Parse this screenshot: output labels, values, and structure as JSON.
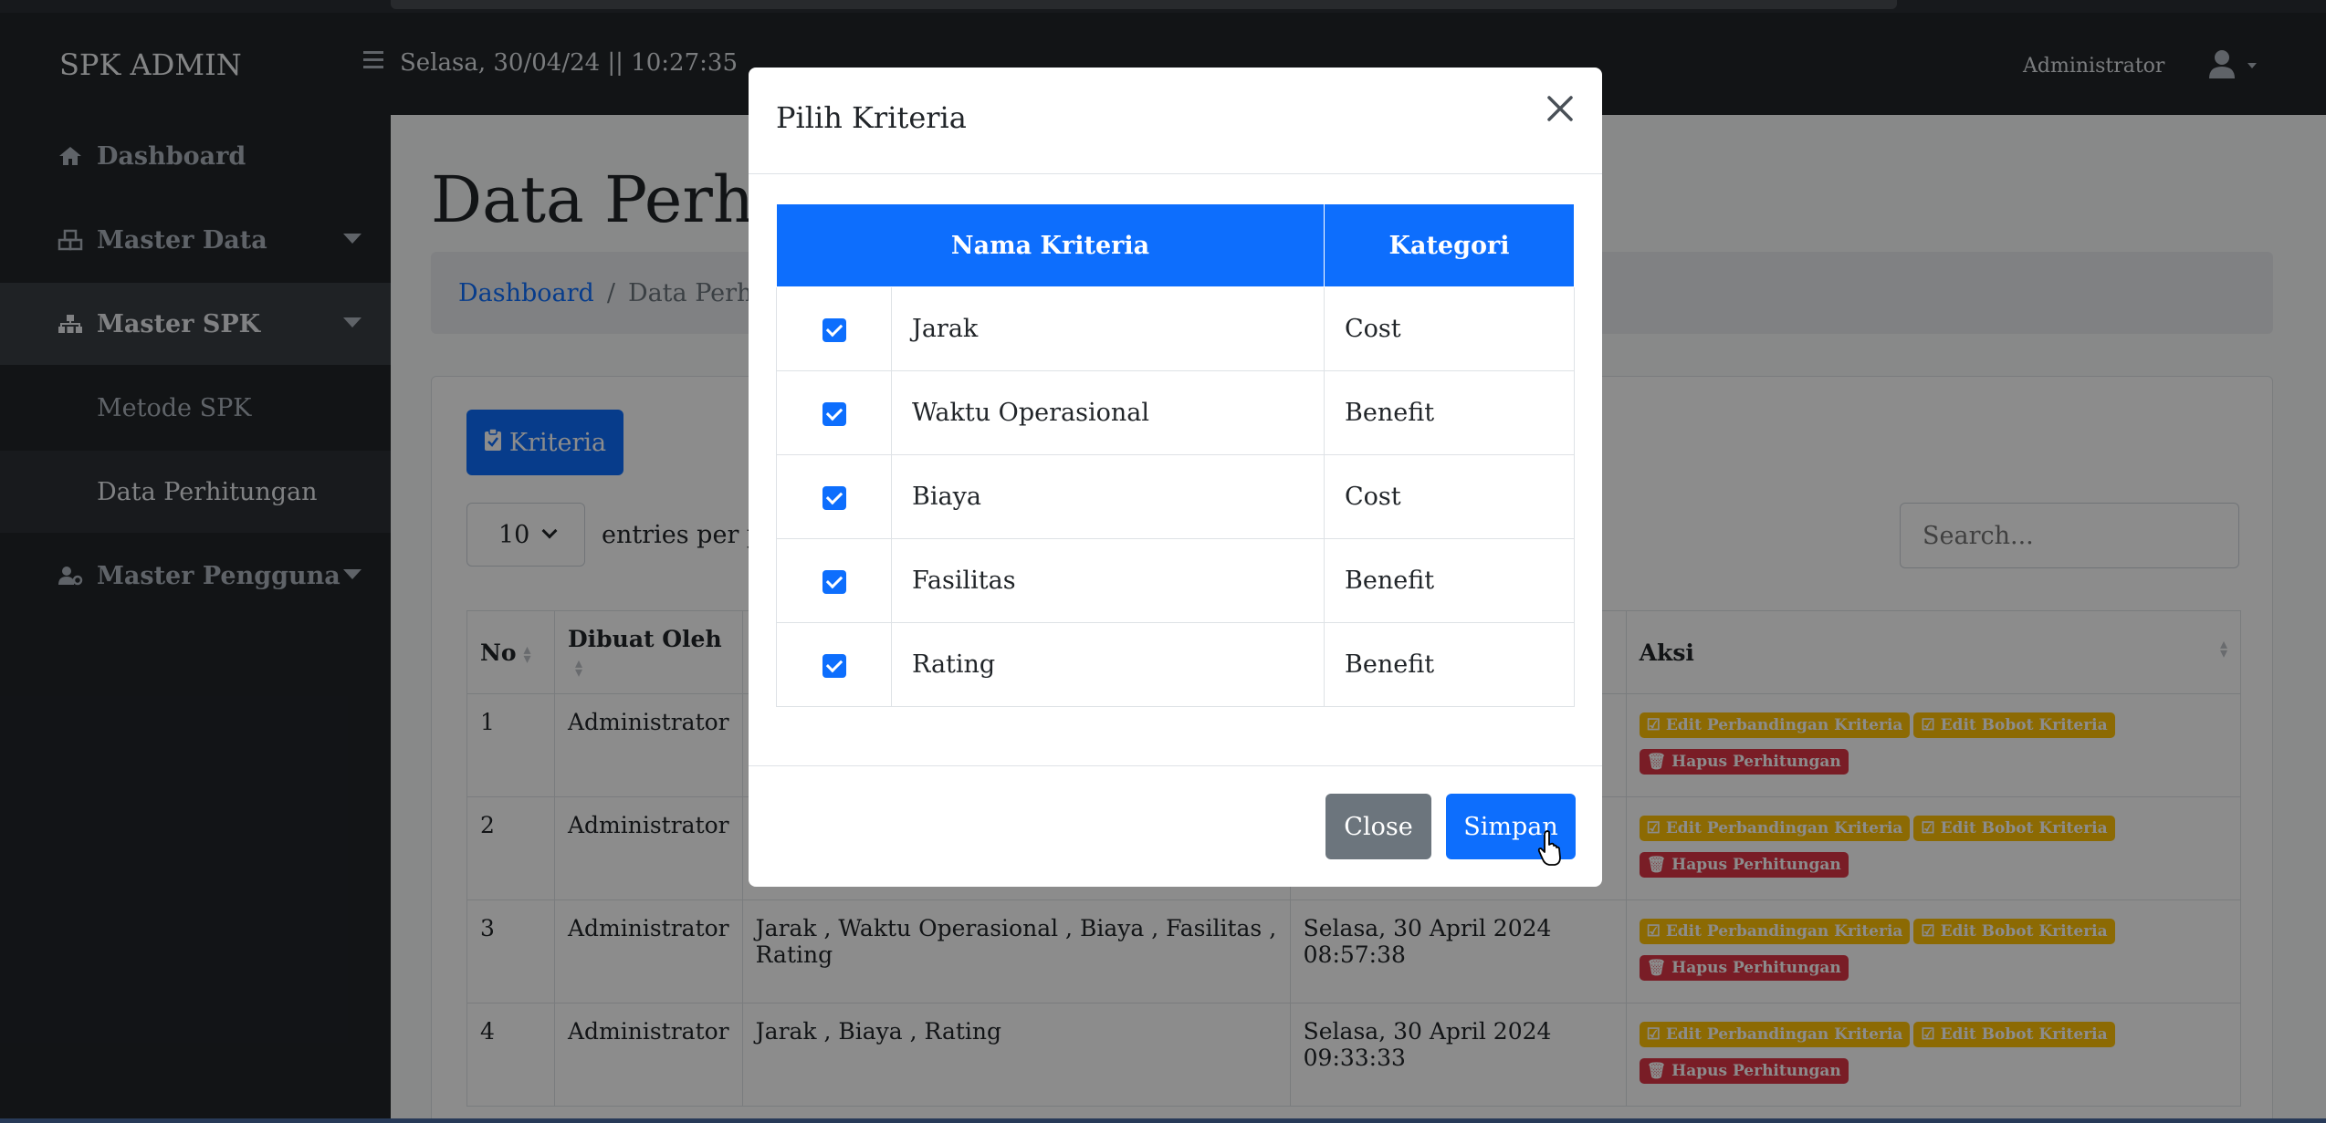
{
  "navbar": {
    "brand": "SPK ADMIN",
    "datetime": "Selasa, 30/04/24 || 10:27:35",
    "user_name": "Administrator"
  },
  "sidebar": {
    "items": [
      {
        "label": "Dashboard",
        "icon": "home-icon"
      },
      {
        "label": "Master Data",
        "icon": "cubes-icon"
      },
      {
        "label": "Master SPK",
        "icon": "sitemap-icon"
      },
      {
        "label": "Metode SPK"
      },
      {
        "label": "Data Perhitungan"
      },
      {
        "label": "Master Pengguna",
        "icon": "users-gear-icon"
      }
    ]
  },
  "main": {
    "title": "Data Perhitu",
    "breadcrumb": {
      "home": "Dashboard",
      "current": "Data Perhitu"
    },
    "kriteria_button": "Kriteria",
    "entries_value": "10",
    "entries_label": "entries per pa",
    "search_placeholder": "Search...",
    "table": {
      "headers": [
        "No",
        "Dibuat Oleh",
        "",
        "",
        "Aksi"
      ],
      "rows": [
        {
          "no": "1",
          "by": "Administrator",
          "kriteria": "",
          "date": ""
        },
        {
          "no": "2",
          "by": "Administrator",
          "kriteria": "",
          "date": ""
        },
        {
          "no": "3",
          "by": "Administrator",
          "kriteria": "Jarak , Waktu Operasional , Biaya , Fasilitas , Rating",
          "date": "Selasa, 30 April 2024 08:57:38"
        },
        {
          "no": "4",
          "by": "Administrator",
          "kriteria": "Jarak , Biaya , Rating",
          "date": "Selasa, 30 April 2024 09:33:33"
        }
      ],
      "actions": {
        "edit_perbandingan": "Edit Perbandingan Kriteria",
        "edit_bobot": "Edit Bobot Kriteria",
        "hapus": "Hapus Perhitungan"
      }
    }
  },
  "modal": {
    "title": "Pilih Kriteria",
    "headers": {
      "nama": "Nama Kriteria",
      "kategori": "Kategori"
    },
    "rows": [
      {
        "nama": "Jarak",
        "kategori": "Cost",
        "checked": true
      },
      {
        "nama": "Waktu Operasional",
        "kategori": "Benefit",
        "checked": true
      },
      {
        "nama": "Biaya",
        "kategori": "Cost",
        "checked": true
      },
      {
        "nama": "Fasilitas",
        "kategori": "Benefit",
        "checked": true
      },
      {
        "nama": "Rating",
        "kategori": "Benefit",
        "checked": true
      }
    ],
    "close_label": "Close",
    "save_label": "Simpan"
  },
  "colors": {
    "primary": "#0d6efd",
    "secondary": "#6c757d",
    "warning": "#ffc107",
    "danger": "#dc3545",
    "sidebar": "#212529"
  }
}
